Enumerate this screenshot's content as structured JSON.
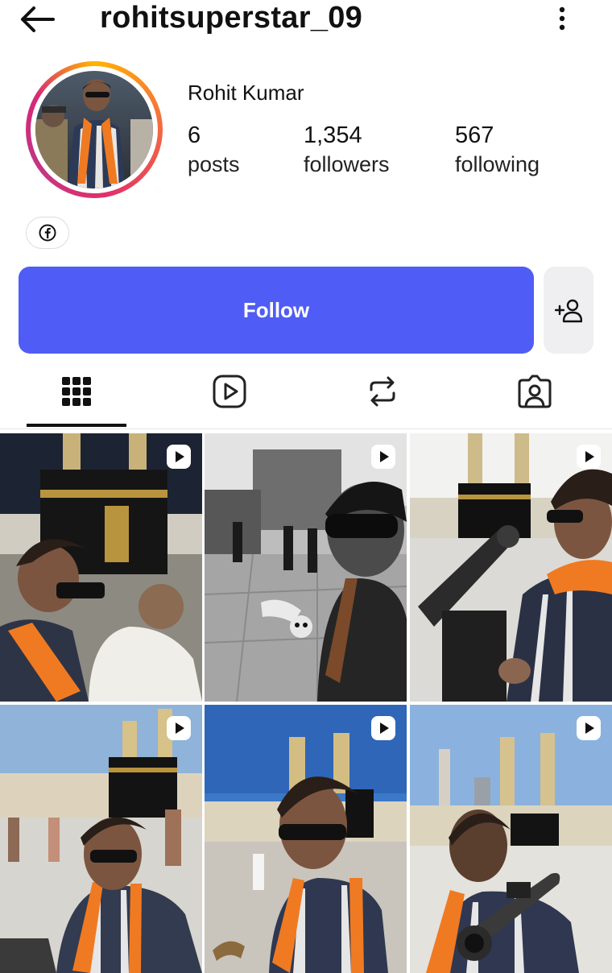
{
  "header": {
    "username": "rohitsuperstar_09",
    "back_icon": "arrow-left-icon",
    "more_icon": "more-vertical-icon"
  },
  "profile": {
    "full_name": "Rohit Kumar",
    "stats": [
      {
        "value": "6",
        "label": "posts"
      },
      {
        "value": "1,354",
        "label": "followers"
      },
      {
        "value": "567",
        "label": "following"
      }
    ],
    "link_icon": "facebook-icon"
  },
  "actions": {
    "follow_label": "Follow",
    "follow_color": "#4f5cf5",
    "suggest_icon": "add-person-icon"
  },
  "tabs": [
    {
      "name": "grid",
      "icon": "grid-icon",
      "selected": true
    },
    {
      "name": "reels",
      "icon": "reels-icon",
      "selected": false
    },
    {
      "name": "reposts",
      "icon": "repost-icon",
      "selected": false
    },
    {
      "name": "tagged",
      "icon": "tagged-icon",
      "selected": false
    }
  ],
  "posts": [
    {
      "type": "reel",
      "icon": "reel-icon"
    },
    {
      "type": "reel",
      "icon": "reel-icon"
    },
    {
      "type": "reel",
      "icon": "reel-icon"
    },
    {
      "type": "reel",
      "icon": "reel-icon"
    },
    {
      "type": "reel",
      "icon": "reel-icon"
    },
    {
      "type": "reel",
      "icon": "reel-icon"
    }
  ]
}
